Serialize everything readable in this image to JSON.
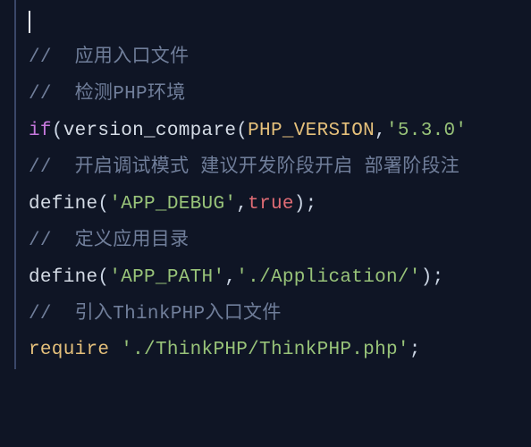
{
  "lines": {
    "l1_cursor": "",
    "l2_comment": "//  应用入口文件",
    "l3_blank": "",
    "l4_comment": "//  检测PHP环境",
    "l5": {
      "t1_keyword": "if",
      "t2_punct": "(",
      "t3_func": "version_compare",
      "t4_punct": "(",
      "t5_const": "PHP_VERSION",
      "t6_punct": ",",
      "t7_string": "'5.3.0'"
    },
    "l6_blank": "",
    "l7_comment": "//  开启调试模式 建议开发阶段开启 部署阶段注",
    "l8": {
      "t1_func": "define",
      "t2_punct": "(",
      "t3_string": "'APP_DEBUG'",
      "t4_punct": ",",
      "t5_bool": "true",
      "t6_punct": ");"
    },
    "l9_blank": "",
    "l10_comment": "//  定义应用目录",
    "l11": {
      "t1_func": "define",
      "t2_punct": "(",
      "t3_string": "'APP_PATH'",
      "t4_punct": ",",
      "t5_string": "'./Application/'",
      "t6_punct": ");"
    },
    "l12_blank": "",
    "l13_comment": "//  引入ThinkPHP入口文件",
    "l14": {
      "t1_require": "require",
      "t2_space": " ",
      "t3_string": "'./ThinkPHP/ThinkPHP.php'",
      "t4_punct": ";"
    }
  }
}
